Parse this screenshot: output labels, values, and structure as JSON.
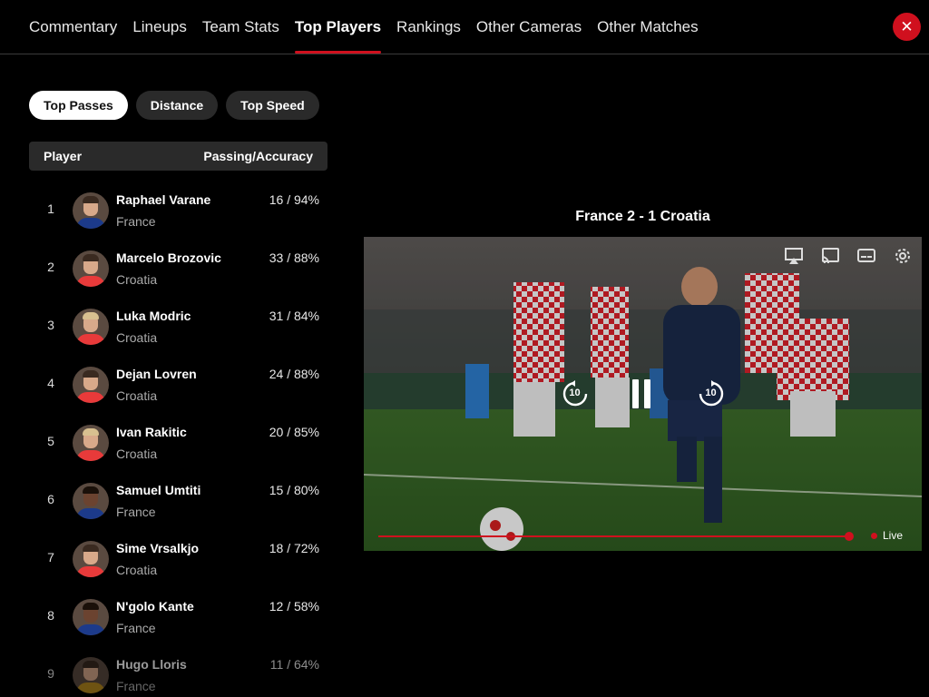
{
  "nav": {
    "tabs": [
      {
        "label": "Commentary"
      },
      {
        "label": "Lineups"
      },
      {
        "label": "Team Stats"
      },
      {
        "label": "Top Players",
        "active": true
      },
      {
        "label": "Rankings"
      },
      {
        "label": "Other Cameras"
      },
      {
        "label": "Other Matches"
      }
    ],
    "close_icon": "close-icon"
  },
  "stat_tabs": [
    {
      "label": "Top Passes",
      "active": true
    },
    {
      "label": "Distance"
    },
    {
      "label": "Top Speed"
    }
  ],
  "table": {
    "col_player": "Player",
    "col_stat": "Passing/Accuracy",
    "rows": [
      {
        "rank": "1",
        "name": "Raphael Varane",
        "team": "France",
        "stat": "16 / 94%"
      },
      {
        "rank": "2",
        "name": "Marcelo Brozovic",
        "team": "Croatia",
        "stat": "33 / 88%"
      },
      {
        "rank": "3",
        "name": "Luka Modric",
        "team": "Croatia",
        "stat": "31 / 84%"
      },
      {
        "rank": "4",
        "name": "Dejan Lovren",
        "team": "Croatia",
        "stat": "24 / 88%"
      },
      {
        "rank": "5",
        "name": "Ivan Rakitic",
        "team": "Croatia",
        "stat": "20 / 85%"
      },
      {
        "rank": "6",
        "name": "Samuel Umtiti",
        "team": "France",
        "stat": "15 / 80%"
      },
      {
        "rank": "7",
        "name": "Sime Vrsalkjo",
        "team": "Croatia",
        "stat": "18 / 72%"
      },
      {
        "rank": "8",
        "name": "N'golo Kante",
        "team": "France",
        "stat": "12 / 58%"
      },
      {
        "rank": "9",
        "name": "Hugo Lloris",
        "team": "France",
        "stat": "11 / 64%"
      }
    ]
  },
  "player": {
    "title": "France 2 - 1 Croatia",
    "rewind_label": "10",
    "forward_label": "10",
    "live_label": "Live",
    "progress": 0.97
  },
  "colors": {
    "accent": "#d0101e",
    "france": "#1c3a8a",
    "croatia": "#e83a3a"
  }
}
